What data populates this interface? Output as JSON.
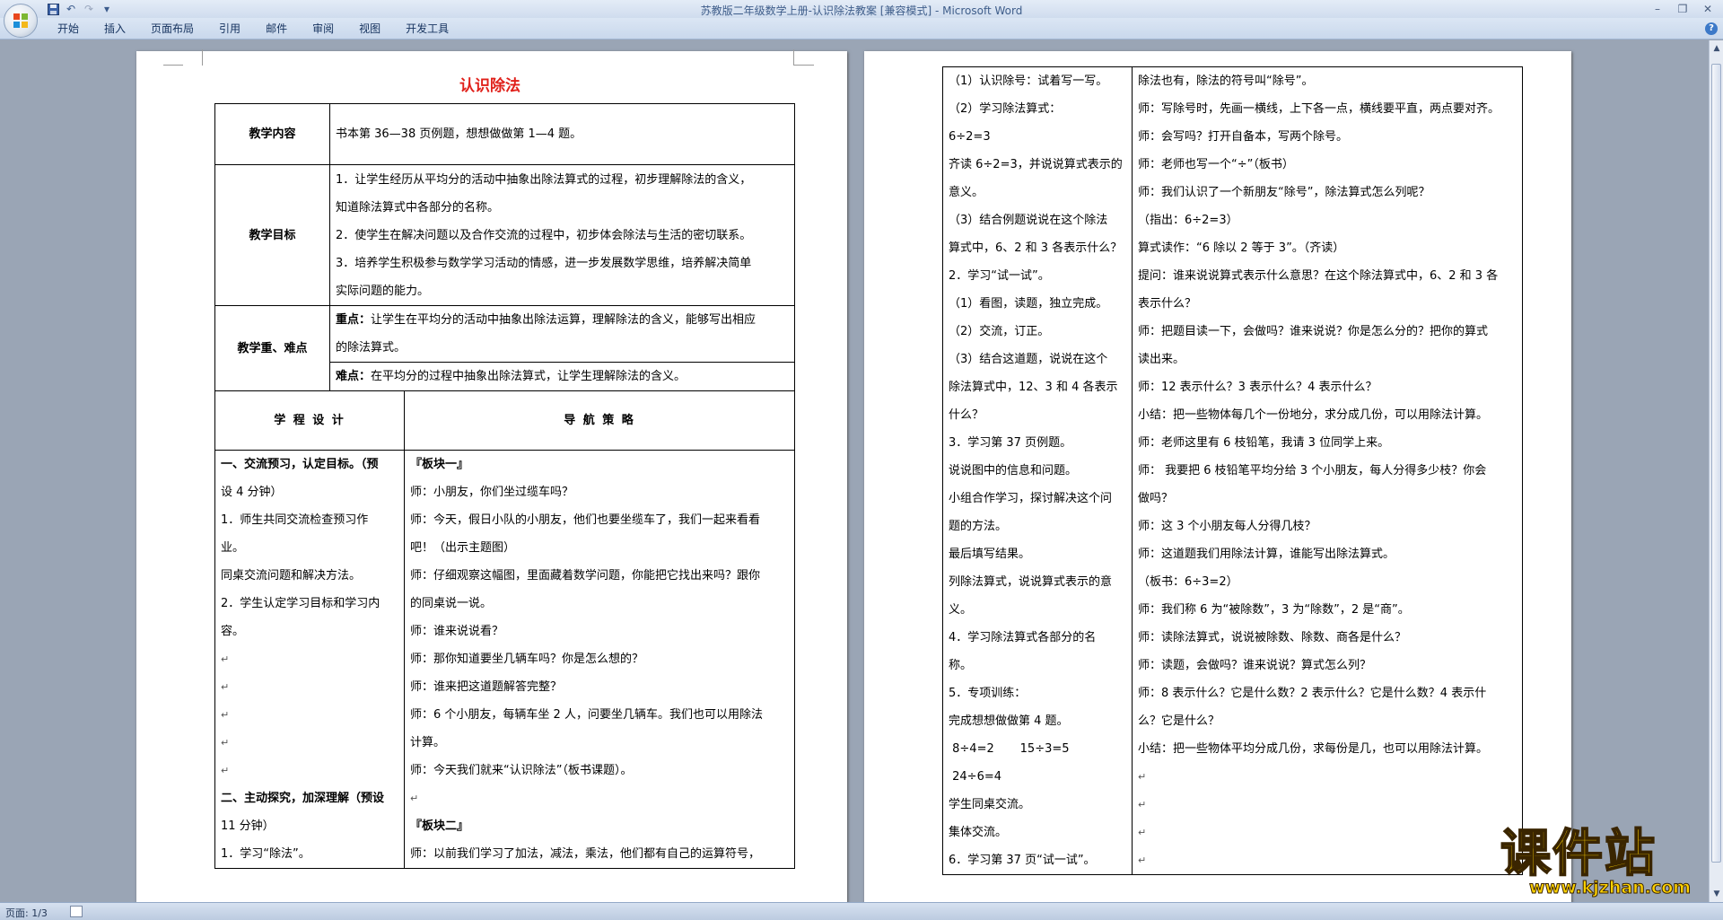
{
  "window": {
    "title": "苏教版二年级数学上册-认识除法教案 [兼容模式] - Microsoft Word"
  },
  "qat": {
    "save_icon": "save-icon",
    "undo_icon": "undo-icon",
    "redo_icon": "redo-icon",
    "more": "▾"
  },
  "ribbon": {
    "tabs": [
      "开始",
      "插入",
      "页面布局",
      "引用",
      "邮件",
      "审阅",
      "视图",
      "开发工具"
    ]
  },
  "page1": {
    "title": "认识除法",
    "content_label": "教学内容",
    "content_text": "书本第 36—38 页例题，想想做做第 1—4 题。",
    "goal_label": "教学目标",
    "goal_lines": [
      "1．让学生经历从平均分的活动中抽象出除法算式的过程，初步理解除法的含义，",
      "知道除法算式中各部分的名称。",
      "2．使学生在解决问题以及合作交流的过程中，初步体会除法与生活的密切联系。",
      "3．培养学生积极参与数学学习活动的情感，进一步发展数学思维，培养解决简单",
      "实际问题的能力。"
    ],
    "key_label": "教学重、难点",
    "key_point_label": "重点：",
    "key_point_lines": [
      "让学生在平均分的活动中抽象出除法运算，理解除法的含义，能够写出相应",
      "的除法算式。"
    ],
    "difficulty_label": "难点：",
    "difficulty_text": "在平均分的过程中抽象出除法算式，让学生理解除法的含义。",
    "col_left_header": "学 程 设 计",
    "col_right_header": "导 航 策 略",
    "left_lines": [
      "一、交流预习，认定目标。（预",
      "设 4 分钟）",
      "1．师生共同交流检查预习作",
      "业。",
      "同桌交流问题和解决方法。",
      "2．学生认定学习目标和学习内",
      "容。",
      "",
      "",
      "",
      "",
      "",
      "二、主动探究，加深理解（预设",
      "11 分钟）",
      "1．学习“除法”。"
    ],
    "right_lines": [
      "『板块一』",
      "师：小朋友，你们坐过缆车吗？",
      "师：今天，假日小队的小朋友，他们也要坐缆车了，我们一起来看看",
      "吧！（出示主题图）",
      "师：仔细观察这幅图，里面藏着数学问题，你能把它找出来吗？跟你",
      "的同桌说一说。",
      "师：谁来说说看？",
      "师：那你知道要坐几辆车吗？你是怎么想的？",
      "师：谁来把这道题解答完整？",
      "师：6 个小朋友，每辆车坐 2 人，问要坐几辆车。我们也可以用除法",
      "计算。",
      "师：今天我们就来“认识除法”（板书课题）。",
      "",
      "『板块二』",
      "师：以前我们学习了加法，减法，乘法，他们都有自己的运算符号，"
    ]
  },
  "page2": {
    "left_lines": [
      "（1）认识除号：试着写一写。",
      "（2）学习除法算式：",
      " 6÷2=3",
      "齐读 6÷2=3，并说说算式表示的",
      "意义。",
      "（3）结合例题说说在这个除法",
      "算式中，6、2 和 3 各表示什么？",
      "2．学习“试一试”。",
      "（1）看图，读题，独立完成。",
      "（2）交流，订正。",
      "（3）结合这道题，说说在这个",
      "除法算式中，12、3 和 4 各表示",
      "什么？",
      "3．学习第 37 页例题。",
      "说说图中的信息和问题。",
      "小组合作学习，探讨解决这个问",
      "题的方法。",
      "最后填写结果。",
      "列除法算式，说说算式表示的意",
      "义。",
      "4．学习除法算式各部分的名",
      "称。",
      "5．专项训练：",
      "完成想想做做第 4 题。",
      " 8÷4=2       15÷3=5",
      " 24÷6=4",
      "学生同桌交流。",
      "集体交流。",
      "6．学习第 37 页“试一试”。"
    ],
    "right_lines": [
      "除法也有，除法的符号叫“除号”。",
      "师：写除号时，先画一横线，上下各一点，横线要平直，两点要对齐。",
      "师：会写吗？打开自备本，写两个除号。",
      "师：老师也写一个“÷”（板书）",
      "师：我们认识了一个新朋友“除号”，除法算式怎么列呢？",
      "（指出：6÷2=3）",
      "算式读作：“6 除以 2 等于 3”。（齐读）",
      "提问：谁来说说算式表示什么意思？在这个除法算式中，6、2 和 3 各",
      "表示什么？",
      "师：把题目读一下，会做吗？谁来说说？你是怎么分的？把你的算式",
      "读出来。",
      "师：12 表示什么？3 表示什么？4 表示什么？",
      "小结：把一些物体每几个一份地分，求分成几份，可以用除法计算。",
      "师：老师这里有 6 枝铅笔，我请 3 位同学上来。",
      "师： 我要把 6 枝铅笔平均分给 3 个小朋友，每人分得多少枝？你会",
      "做吗？",
      "师：这 3 个小朋友每人分得几枝？",
      "师：这道题我们用除法计算，谁能写出除法算式。",
      "（板书：6÷3=2）",
      "师：我们称 6 为“被除数”，3 为“除数”，2 是“商”。",
      "师：读除法算式，说说被除数、除数、商各是什么？",
      "师：读题，会做吗？谁来说说？算式怎么列？",
      "师：8 表示什么？它是什么数？2 表示什么？它是什么数？4 表示什",
      "么？它是什么？",
      "小结：把一些物体平均分成几份，求每份是几，也可以用除法计算。",
      "",
      "",
      "",
      ""
    ]
  },
  "paragraph_mark": "↵",
  "status": {
    "page": "页面: 1/3"
  },
  "watermark": {
    "brand": "课件站",
    "url": "www.kjzhan.com"
  },
  "colors": {
    "title_red": "#e0201a",
    "watermark_yellow": "#ffd200",
    "ribbon_blue": "#dbe6f4"
  }
}
